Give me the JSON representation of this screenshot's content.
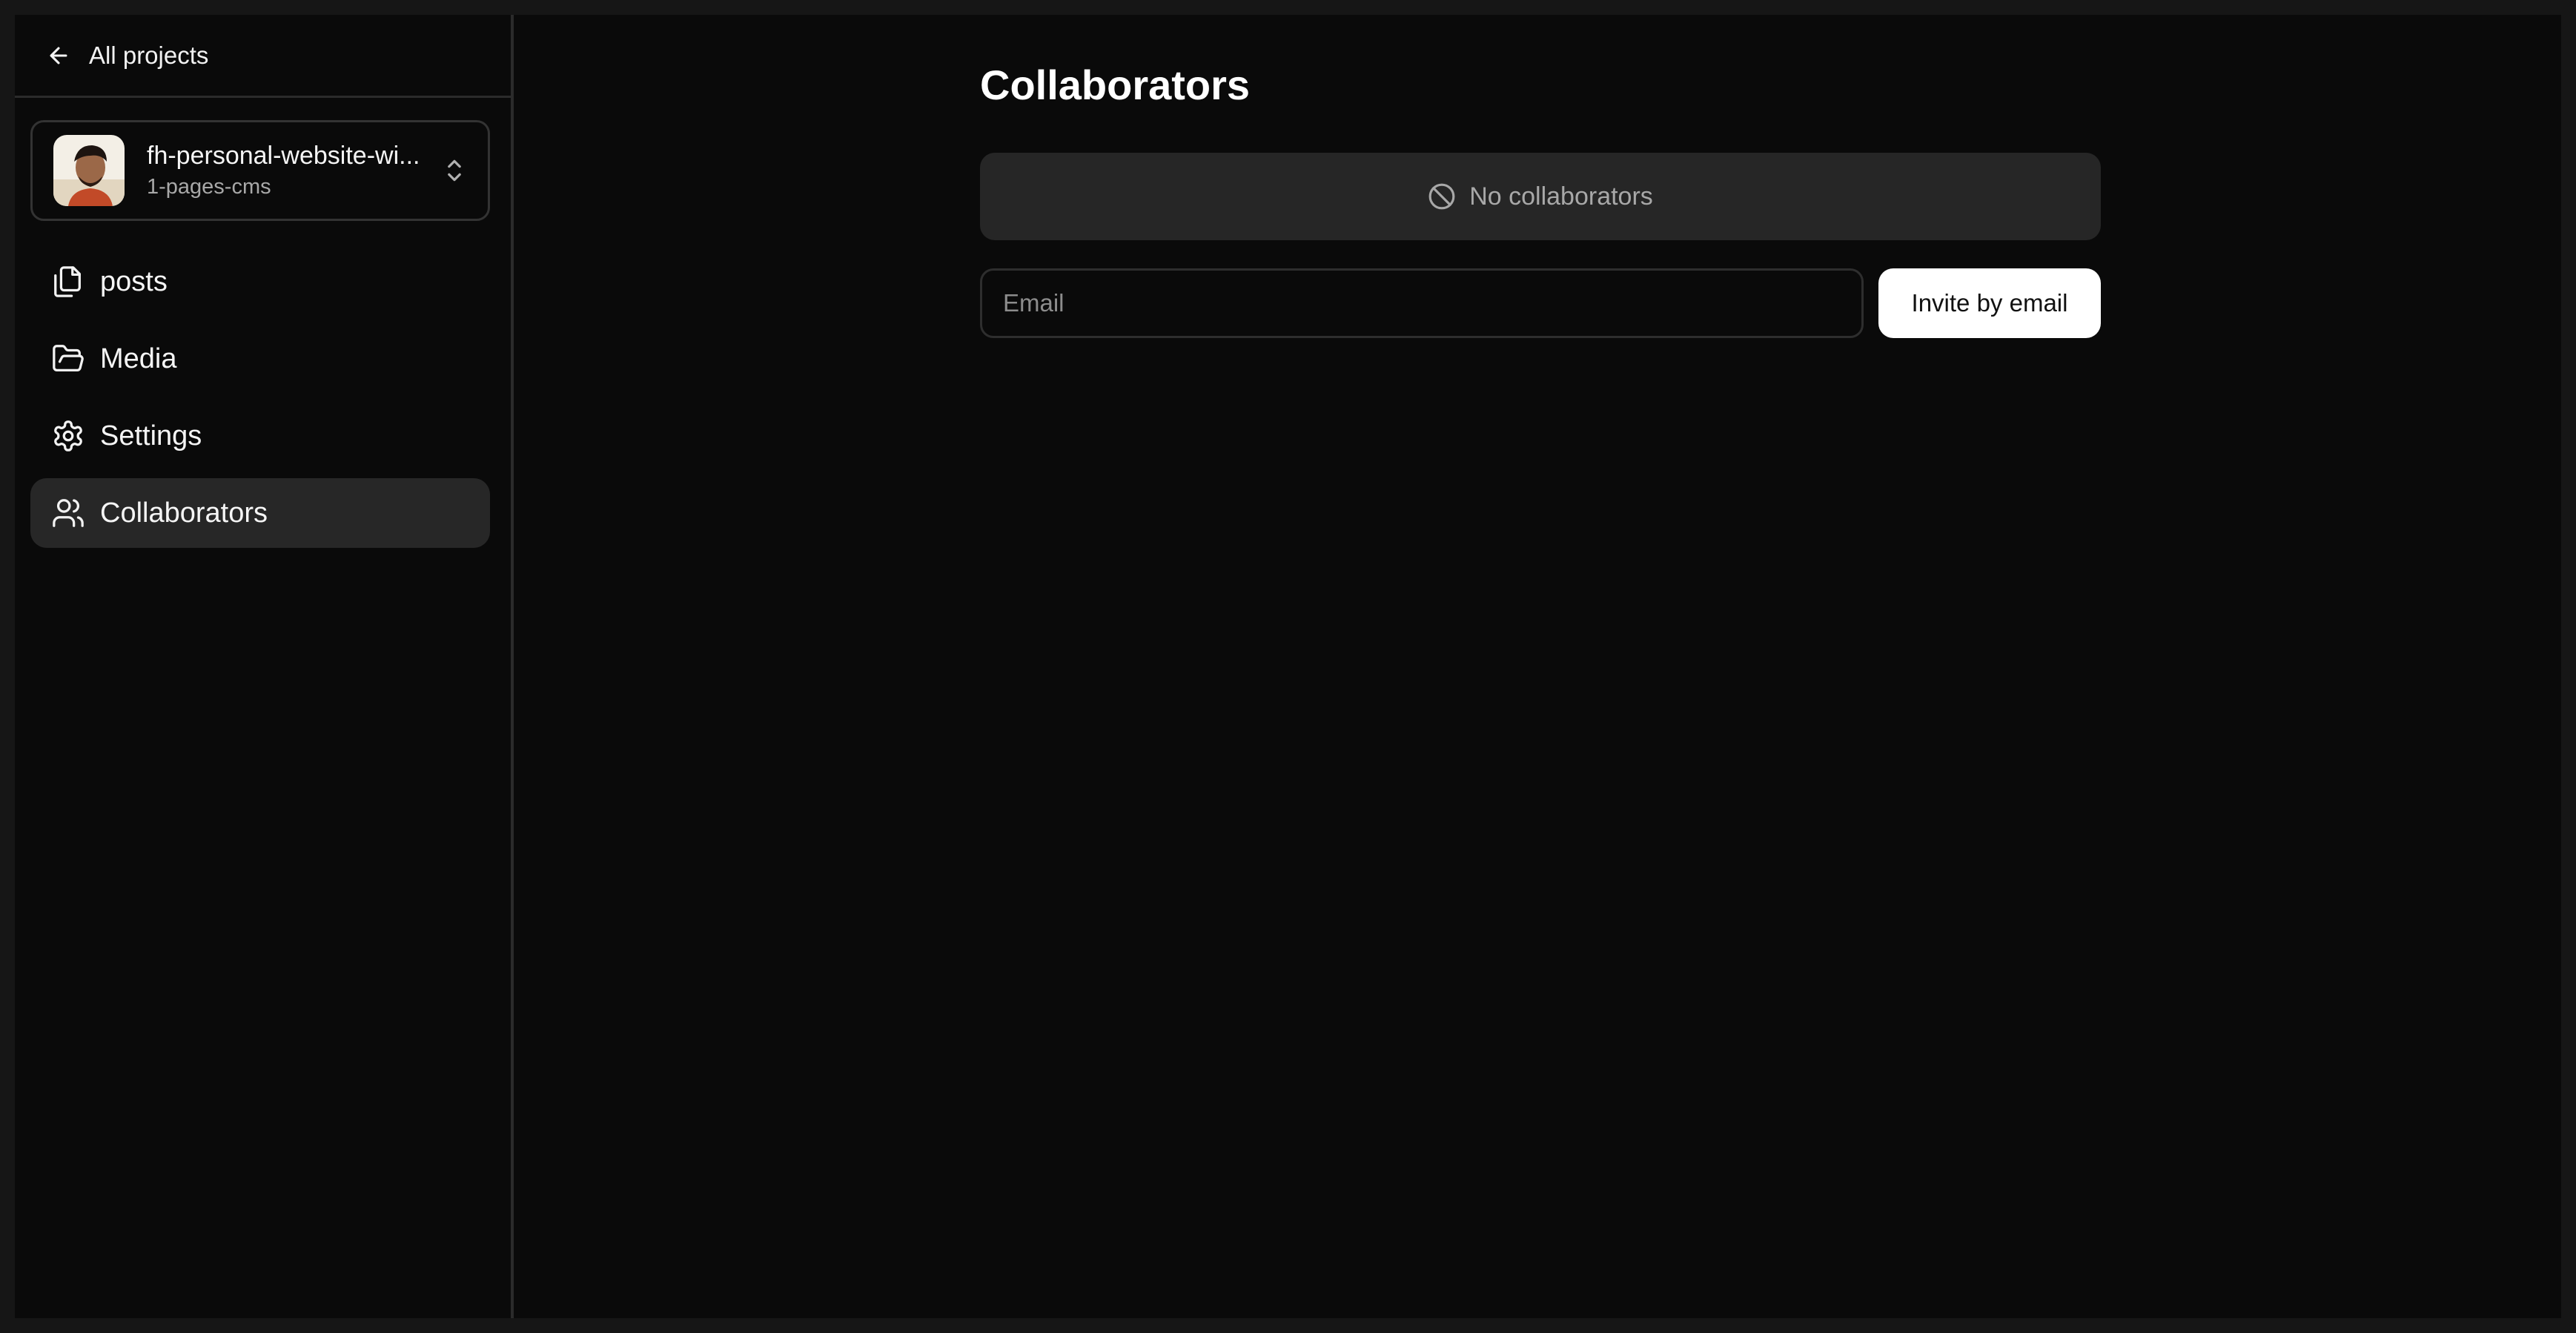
{
  "sidebar": {
    "back_label": "All projects",
    "project": {
      "name": "fh-personal-website-wi...",
      "branch": "1-pages-cms"
    },
    "items": [
      {
        "label": "posts",
        "icon": "files-icon"
      },
      {
        "label": "Media",
        "icon": "folder-open-icon"
      },
      {
        "label": "Settings",
        "icon": "gear-icon"
      },
      {
        "label": "Collaborators",
        "icon": "users-icon",
        "active": true
      }
    ]
  },
  "main": {
    "title": "Collaborators",
    "empty_text": "No collaborators",
    "email_placeholder": "Email",
    "invite_label": "Invite by email"
  },
  "colors": {
    "background": "#0a0a0a",
    "active_item": "#272727",
    "button_bg": "#ffffff"
  }
}
